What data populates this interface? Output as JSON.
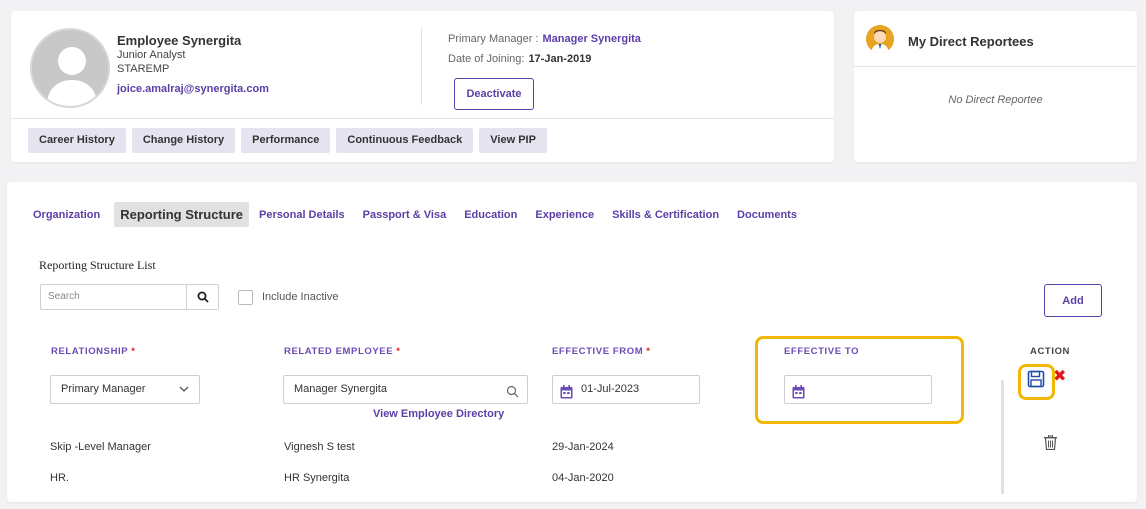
{
  "profile": {
    "name": "Employee Synergita",
    "title": "Junior Analyst",
    "code": "STAREMP",
    "email": "joice.amalraj@synergita.com",
    "primary_manager_label": "Primary Manager :",
    "primary_manager": "Manager Synergita",
    "doj_label": "Date of Joining:",
    "doj": "17-Jan-2019",
    "deactivate_label": "Deactivate",
    "tabs": [
      "Career History",
      "Change History",
      "Performance",
      "Continuous Feedback",
      "View PIP"
    ]
  },
  "reportees": {
    "title": "My Direct Reportees",
    "empty_text": "No Direct Reportee"
  },
  "nav_tabs": [
    "Organization",
    "Reporting Structure",
    "Personal Details",
    "Passport & Visa",
    "Education",
    "Experience",
    "Skills & Certification",
    "Documents"
  ],
  "active_tab": "Reporting Structure",
  "section_title": "Reporting Structure List",
  "search": {
    "placeholder": "Search"
  },
  "include_inactive_label": "Include Inactive",
  "add_label": "Add",
  "columns": {
    "relationship": "RELATIONSHIP",
    "related_employee": "RELATED EMPLOYEE",
    "effective_from": "EFFECTIVE FROM",
    "effective_to": "EFFECTIVE TO",
    "action": "ACTION",
    "required_mark": "*"
  },
  "edit_row": {
    "relationship": "Primary Manager",
    "related_employee": "Manager Synergita",
    "view_directory": "View Employee Directory",
    "effective_from": "01-Jul-2023",
    "effective_to": ""
  },
  "rows": [
    {
      "relationship": "Skip -Level Manager",
      "employee": "Vignesh S test",
      "from": "29-Jan-2024"
    },
    {
      "relationship": "HR.",
      "employee": "HR Synergita",
      "from": "04-Jan-2020"
    }
  ],
  "colors": {
    "accent": "#5b3fa6",
    "highlight": "#f2b705",
    "danger": "#e01919"
  }
}
